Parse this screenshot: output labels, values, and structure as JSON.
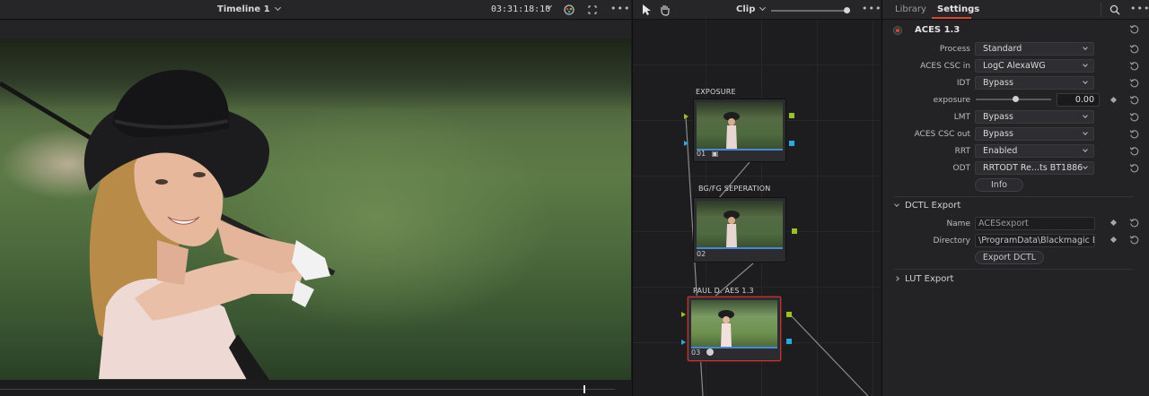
{
  "viewer": {
    "timeline_title": "Timeline 1",
    "timecode": "03:31:18:10"
  },
  "node_graph": {
    "clip_label": "Clip",
    "nodes": [
      {
        "label": "EXPOSURE",
        "number": "01"
      },
      {
        "label": "BG/FG SEPERATION",
        "number": "02"
      },
      {
        "label": "PAUL D. AES 1.3",
        "number": "03"
      }
    ]
  },
  "settings_panel": {
    "tabs": [
      "Library",
      "Settings"
    ],
    "active_tab": "Settings",
    "plugin_title": "ACES 1.3",
    "params": {
      "process": {
        "label": "Process",
        "value": "Standard"
      },
      "aces_csc_in": {
        "label": "ACES CSC in",
        "value": "LogC AlexaWG"
      },
      "idt": {
        "label": "IDT",
        "value": "Bypass"
      },
      "exposure": {
        "label": "exposure",
        "value": "0.00"
      },
      "lmt": {
        "label": "LMT",
        "value": "Bypass"
      },
      "aces_csc_out": {
        "label": "ACES CSC out",
        "value": "Bypass"
      },
      "rrt": {
        "label": "RRT",
        "value": "Enabled"
      },
      "odt": {
        "label": "ODT",
        "value": "RRTODT Re...ts BT1886"
      }
    },
    "info_button": "Info",
    "dctl_export": {
      "title": "DCTL Export",
      "name_label": "Name",
      "name_value": "ACESexport",
      "directory_label": "Directory",
      "directory_value": "\\ProgramData\\Blackmagic De",
      "export_button": "Export DCTL"
    },
    "lut_export": {
      "title": "LUT Export"
    }
  },
  "colors": {
    "accent_red": "#d9472f",
    "port_green": "#9bc31e",
    "port_blue": "#28a9e0",
    "selected_node_border": "#b33a36"
  }
}
